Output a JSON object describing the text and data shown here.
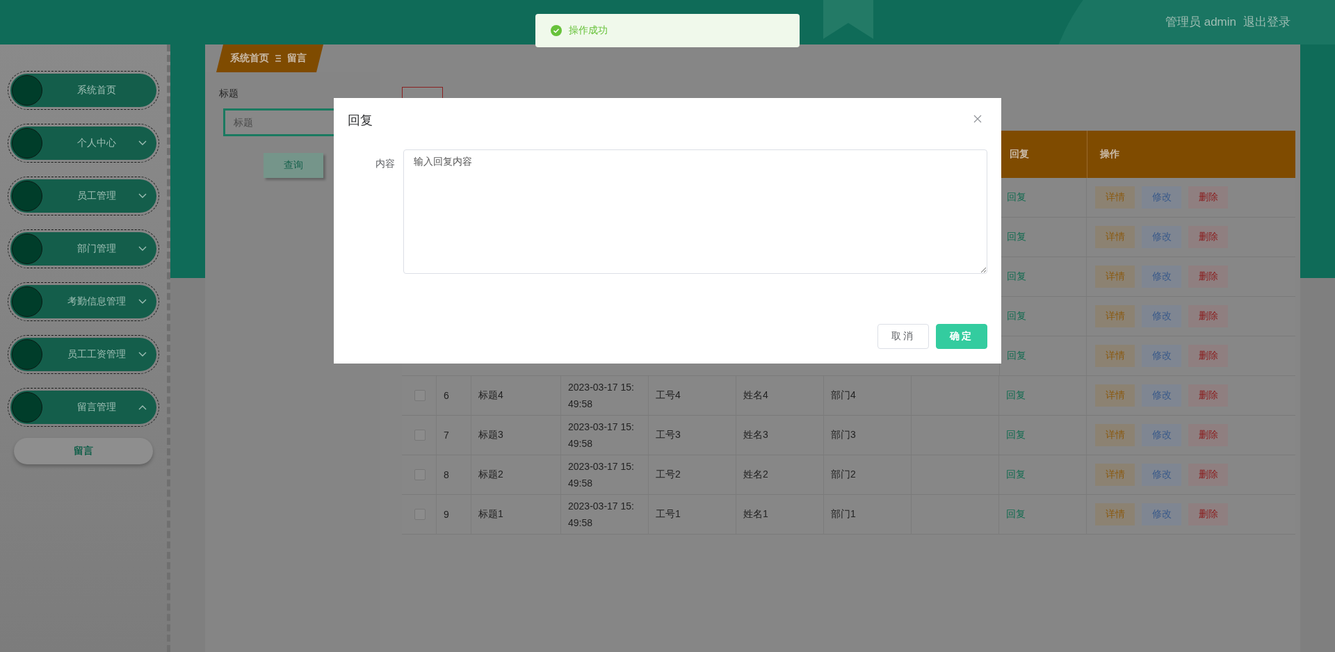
{
  "header": {
    "user": "管理员 admin",
    "logout": "退出登录"
  },
  "toast": {
    "message": "操作成功"
  },
  "sidebar": {
    "items": [
      {
        "label": "系统首页",
        "kind": "link"
      },
      {
        "label": "个人中心",
        "kind": "menu",
        "expanded": false
      },
      {
        "label": "员工管理",
        "kind": "menu",
        "expanded": false
      },
      {
        "label": "部门管理",
        "kind": "menu",
        "expanded": false
      },
      {
        "label": "考勤信息管理",
        "kind": "menu",
        "expanded": false
      },
      {
        "label": "员工工资管理",
        "kind": "menu",
        "expanded": false
      },
      {
        "label": "留言管理",
        "kind": "menu",
        "expanded": true,
        "children": [
          {
            "label": "留言"
          }
        ]
      }
    ]
  },
  "breadcrumb": [
    "系统首页",
    "留言"
  ],
  "search": {
    "label": "标题",
    "placeholder": "标题",
    "button": "查询"
  },
  "table": {
    "columns": [
      "回复",
      "操作"
    ],
    "rows": [
      {
        "kind": "hidden",
        "reply": "回复",
        "actions": [
          "详情",
          "修改",
          "删除"
        ]
      },
      {
        "kind": "hidden",
        "reply": "回复",
        "actions": [
          "详情",
          "修改",
          "删除"
        ]
      },
      {
        "kind": "hidden",
        "reply": "回复",
        "actions": [
          "详情",
          "修改",
          "删除"
        ]
      },
      {
        "kind": "hidden",
        "reply": "回复",
        "actions": [
          "详情",
          "修改",
          "删除"
        ]
      },
      {
        "kind": "hidden",
        "reply": "回复",
        "actions": [
          "详情",
          "修改",
          "删除"
        ]
      },
      {
        "kind": "full",
        "checked": false,
        "index": "6",
        "title": "标题4",
        "time": "2023-03-17 15:49:58",
        "number": "工号4",
        "name": "姓名4",
        "department": "部门4",
        "reply": "回复",
        "actions": [
          "详情",
          "修改",
          "删除"
        ]
      },
      {
        "kind": "full",
        "checked": false,
        "index": "7",
        "title": "标题3",
        "time": "2023-03-17 15:49:58",
        "number": "工号3",
        "name": "姓名3",
        "department": "部门3",
        "reply": "回复",
        "actions": [
          "详情",
          "修改",
          "删除"
        ]
      },
      {
        "kind": "full",
        "checked": false,
        "index": "8",
        "title": "标题2",
        "time": "2023-03-17 15:49:58",
        "number": "工号2",
        "name": "姓名2",
        "department": "部门2",
        "reply": "回复",
        "actions": [
          "详情",
          "修改",
          "删除"
        ]
      },
      {
        "kind": "full",
        "checked": false,
        "index": "9",
        "title": "标题1",
        "time": "2023-03-17 15:49:58",
        "number": "工号1",
        "name": "姓名1",
        "department": "部门1",
        "reply": "回复",
        "actions": [
          "详情",
          "修改",
          "删除"
        ]
      }
    ]
  },
  "dialog": {
    "title": "回复",
    "field_label": "内容",
    "placeholder": "输入回复内容",
    "buttons": [
      "取消",
      "确定"
    ]
  }
}
